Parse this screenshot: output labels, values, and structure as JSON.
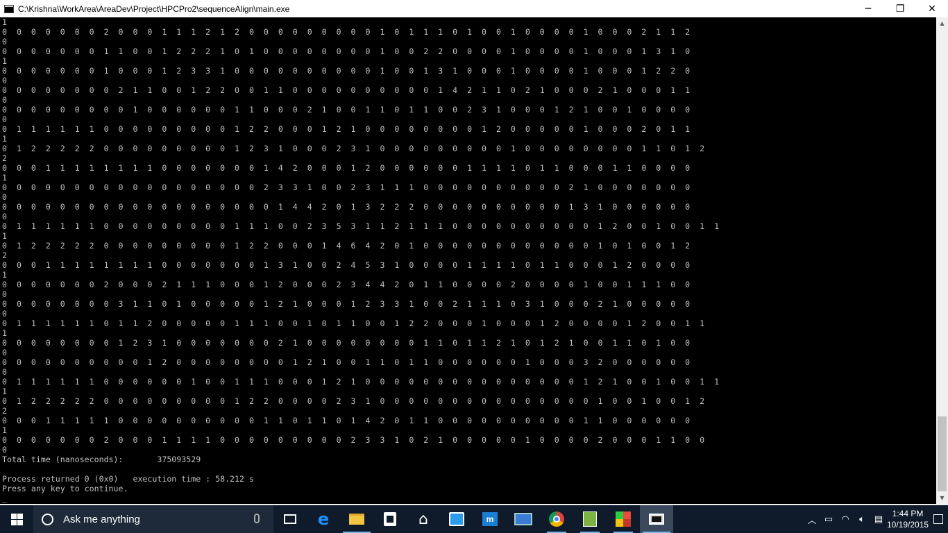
{
  "window": {
    "title": "C:\\Krishna\\WorkArea\\AreaDev\\Project\\HPCPro2\\sequenceAlign\\main.exe",
    "minimize_label": "─",
    "restore_label": "❐",
    "close_label": "✕"
  },
  "console": {
    "lines": [
      "1",
      "0  0  0  0  0  0  0  2  0  0  0  1  1  1  2  1  2  0  0  0  0  0  0  0  0  0  1  0  1  1  1  0  1  0  0  1  0  0  0  0  1  0  0  0  2  1  1  2",
      "0",
      "0  0  0  0  0  0  0  1  1  0  0  1  2  2  2  1  0  1  0  0  0  0  0  0  0  0  1  0  0  2  2  0  0  0  0  1  0  0  0  0  1  0  0  0  1  3  1  0",
      "1",
      "0  0  0  0  0  0  0  1  0  0  0  1  2  3  3  1  0  0  0  0  0  0  0  0  0  0  1  0  0  1  3  1  0  0  0  1  0  0  0  0  1  0  0  0  1  2  2  0",
      "0",
      "0  0  0  0  0  0  0  0  2  1  1  0  0  1  2  2  0  0  1  1  0  0  0  0  0  0  0  0  0  0  1  4  2  1  1  0  2  1  0  0  0  2  1  0  0  0  1  1",
      "0",
      "0  0  0  0  0  0  0  0  0  1  0  0  0  0  0  0  1  1  0  0  0  2  1  0  0  1  1  0  1  1  0  0  2  3  1  0  0  0  1  2  1  0  0  1  0  0  0  0",
      "0",
      "0  1  1  1  1  1  1  0  0  0  0  0  0  0  0  0  1  2  2  0  0  0  1  2  1  0  0  0  0  0  0  0  0  1  2  0  0  0  0  0  1  0  0  0  2  0  1  1",
      "1",
      "0  1  2  2  2  2  2  0  0  0  0  0  0  0  0  0  1  2  3  1  0  0  0  2  3  1  0  0  0  0  0  0  0  0  0  1  0  0  0  0  0  0  0  0  1  1  0  1  2",
      "2",
      "0  0  0  1  1  1  1  1  1  1  1  0  0  0  0  0  0  0  1  4  2  0  0  0  1  2  0  0  0  0  0  0  1  1  1  1  0  1  1  0  0  0  1  1  0  0  0  0",
      "1",
      "0  0  0  0  0  0  0  0  0  0  0  0  0  0  0  0  0  0  2  3  3  1  0  0  2  3  1  1  1  0  0  0  0  0  0  0  0  0  0  2  1  0  0  0  0  0  0  0",
      "0",
      "0  0  0  0  0  0  0  0  0  0  0  0  0  0  0  0  0  0  0  1  4  4  2  0  1  3  2  2  2  0  0  0  0  0  0  0  0  0  0  1  3  1  0  0  0  0  0  0",
      "0",
      "0  1  1  1  1  1  1  0  0  0  0  0  0  0  0  0  1  1  1  0  0  2  3  5  3  1  1  2  1  1  1  0  0  0  0  0  0  0  0  0  0  1  2  0  0  1  0  0  1  1",
      "1",
      "0  1  2  2  2  2  2  0  0  0  0  0  0  0  0  0  1  2  2  0  0  0  1  4  6  4  2  0  1  0  0  0  0  0  0  0  0  0  0  0  0  1  0  1  0  0  1  2",
      "2",
      "0  0  0  1  1  1  1  1  1  1  1  0  0  0  0  0  0  0  1  3  1  0  0  2  4  5  3  1  0  0  0  0  1  1  1  1  0  1  1  0  0  0  1  2  0  0  0  0",
      "1",
      "0  0  0  0  0  0  0  2  0  0  0  2  1  1  1  0  0  0  1  2  0  0  0  2  3  4  4  2  0  1  1  0  0  0  0  2  0  0  0  0  1  0  0  1  1  1  0  0",
      "0",
      "0  0  0  0  0  0  0  0  3  1  1  0  1  0  0  0  0  0  1  2  1  0  0  0  1  2  3  3  1  0  0  2  1  1  1  0  3  1  0  0  0  2  1  0  0  0  0  0",
      "0",
      "0  1  1  1  1  1  1  0  1  1  2  0  0  0  0  0  1  1  1  0  0  1  0  1  1  0  0  1  2  2  0  0  0  1  0  0  0  1  2  0  0  0  0  1  2  0  0  1  1",
      "1",
      "0  0  0  0  0  0  0  0  1  2  3  1  0  0  0  0  0  0  0  2  1  0  0  0  0  0  0  0  0  1  1  0  1  1  2  1  0  1  2  1  0  0  1  1  0  1  0  0",
      "0",
      "0  0  0  0  0  0  0  0  0  0  1  2  0  0  0  0  0  0  0  0  1  2  1  0  0  1  1  0  1  1  0  0  0  0  0  0  1  0  0  0  3  2  0  0  0  0  0  0",
      "0",
      "0  1  1  1  1  1  1  0  0  0  0  0  0  1  0  0  1  1  1  0  0  0  1  2  1  0  0  0  0  0  0  0  0  0  0  0  0  0  0  0  1  2  1  0  0  1  0  0  1  1",
      "1",
      "0  1  2  2  2  2  2  0  0  0  0  0  0  0  0  0  1  2  2  0  0  0  0  2  3  1  0  0  0  0  0  0  0  0  0  0  0  0  0  0  0  1  0  0  1  0  0  1  2",
      "2",
      "0  0  0  1  1  1  1  1  0  0  0  0  0  0  0  0  0  0  1  1  0  1  1  0  1  4  2  0  1  1  0  0  0  0  0  0  0  0  0  0  1  1  0  0  0  0  0  0",
      "1",
      "0  0  0  0  0  0  0  2  0  0  0  1  1  1  1  0  0  0  0  0  0  0  0  0  2  3  3  1  0  2  1  0  0  0  0  0  1  0  0  0  0  2  0  0  0  1  1  0  0",
      "0",
      "Total time (nanoseconds):       375093529",
      "",
      "Process returned 0 (0x0)   execution time : 58.212 s",
      "Press any key to continue.",
      "_"
    ]
  },
  "taskbar": {
    "search_placeholder": "Ask me anything",
    "time": "1:44 PM",
    "date": "10/19/2015",
    "remote_label": "m"
  },
  "colors": {
    "console_bg": "#000000",
    "console_fg": "#c0c0c0",
    "taskbar_bg": "#0f1a2a",
    "accent": "#76b9ed"
  }
}
